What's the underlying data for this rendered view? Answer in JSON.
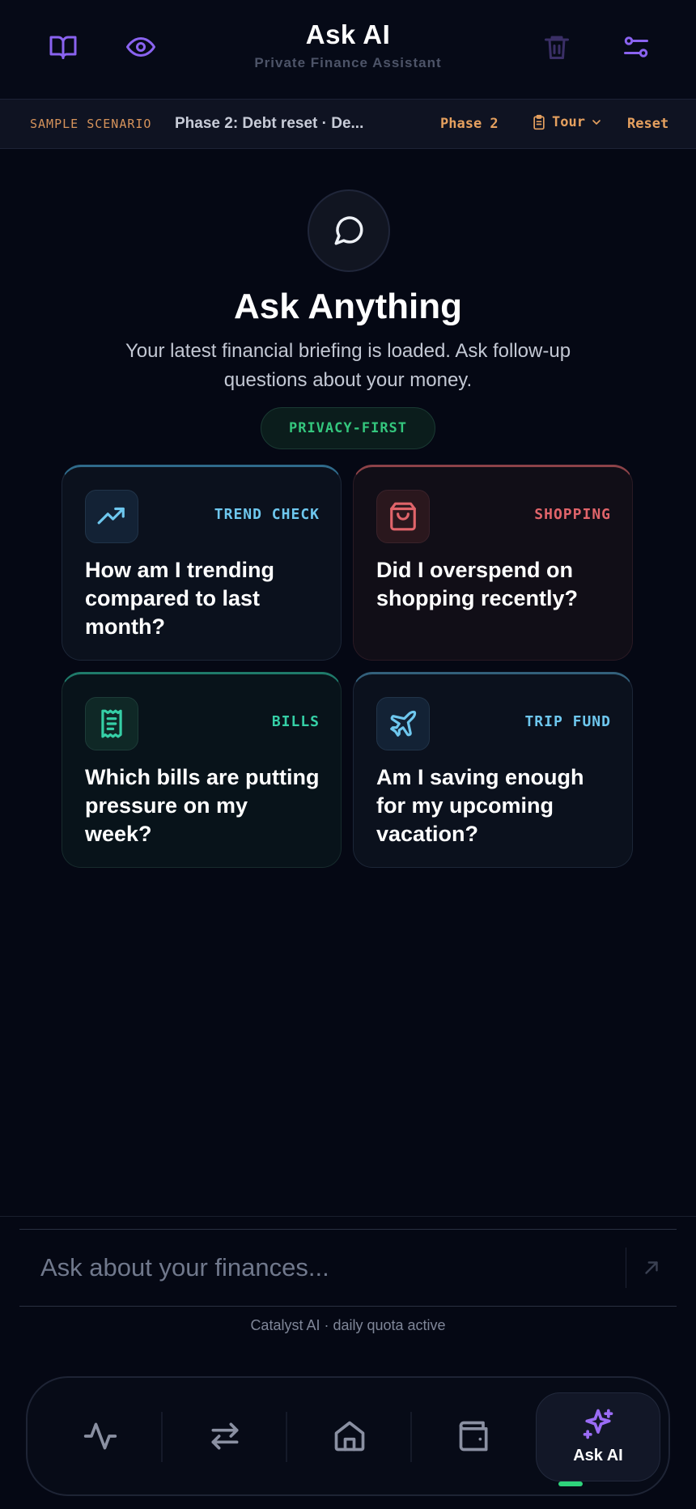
{
  "header": {
    "title": "Ask AI",
    "subtitle": "Private Finance Assistant",
    "icons": [
      "book-icon",
      "eye-icon",
      "trash-icon",
      "settings-sliders-icon"
    ]
  },
  "scenario": {
    "label": "SAMPLE SCENARIO",
    "phase_text": "Phase 2: Debt reset · De...",
    "phase": "Phase 2",
    "tour": "Tour",
    "reset": "Reset"
  },
  "hero": {
    "title": "Ask Anything",
    "subtitle": "Your latest financial briefing is loaded. Ask follow-up questions about your money.",
    "badge": "PRIVACY-FIRST"
  },
  "cards": [
    {
      "tag": "TREND CHECK",
      "question": "How am I trending compared to last month?",
      "icon": "trending-up-icon",
      "color": "#6ec7ee"
    },
    {
      "tag": "SHOPPING",
      "question": "Did I overspend on shopping recently?",
      "icon": "shopping-bag-icon",
      "color": "#e0646a"
    },
    {
      "tag": "BILLS",
      "question": "Which bills are putting pressure on my week?",
      "icon": "receipt-icon",
      "color": "#35cfa6"
    },
    {
      "tag": "TRIP FUND",
      "question": "Am I saving enough for my upcoming vacation?",
      "icon": "plane-icon",
      "color": "#6ec7ee"
    }
  ],
  "input": {
    "placeholder": "Ask about your finances...",
    "quota": "Catalyst AI · daily quota active"
  },
  "nav": {
    "items": [
      "activity-icon",
      "transfer-icon",
      "home-icon",
      "wallet-icon",
      "sparkles-icon"
    ],
    "active_label": "Ask AI"
  },
  "colors": {
    "accent_purple": "#8a63f0",
    "accent_orange": "#e5a05f",
    "accent_green": "#2ed37b",
    "background": "#050814"
  }
}
